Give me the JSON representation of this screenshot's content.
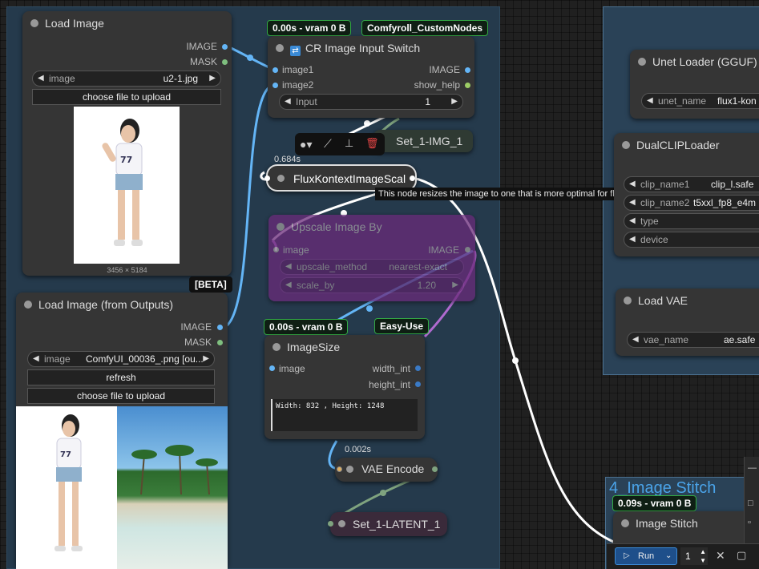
{
  "colors": {
    "canvas": "#202020",
    "group_blue": "#2a4257",
    "node_bg": "#353535",
    "wire_blue": "#64b5f6",
    "wire_white": "#ffffff",
    "wire_green": "#7fa37f",
    "wire_purple": "#b06ad0",
    "accent_blue": "#3a8ad6",
    "delete_red": "#e04444"
  },
  "group_stitch": {
    "title": "4_Image Stitch"
  },
  "load_image": {
    "title": "Load Image",
    "out_image": "IMAGE",
    "out_mask": "MASK",
    "image_label": "image",
    "image_value": "u2-1.jpg",
    "upload_label": "choose file to upload",
    "dims": "3456 × 5184"
  },
  "load_image_outputs": {
    "beta_badge": "[BETA]",
    "title": "Load Image (from Outputs)",
    "out_image": "IMAGE",
    "out_mask": "MASK",
    "image_label": "image",
    "image_value": "ComfyUI_00036_.png [ou...",
    "refresh_label": "refresh",
    "upload_label": "choose file to upload"
  },
  "cr_switch": {
    "badge_time": "0.00s - vram 0 B",
    "badge_pack": "Comfyroll_CustomNodes",
    "title": "CR Image Input Switch",
    "in_image1": "image1",
    "in_image2": "image2",
    "out_image": "IMAGE",
    "out_help": "show_help",
    "input_label": "Input",
    "input_value": "1"
  },
  "set_img": {
    "title": "Set_1-IMG_1"
  },
  "flux_scale": {
    "time": "0.684s",
    "title": "FluxKontextImageScal",
    "tooltip": "This node resizes the image to one that is more optimal for flux kontext."
  },
  "upscale": {
    "title": "Upscale Image By",
    "in_image": "image",
    "out_image": "IMAGE",
    "method_label": "upscale_method",
    "method_value": "nearest-exact",
    "scale_label": "scale_by",
    "scale_value": "1.20"
  },
  "image_size": {
    "badge_time": "0.00s - vram 0 B",
    "badge_pack": "Easy-Use",
    "title": "ImageSize",
    "in_image": "image",
    "out_width": "width_int",
    "out_height": "height_int",
    "display": "Width: 832 , Height: 1248"
  },
  "vae_encode": {
    "time": "0.002s",
    "title": "VAE Encode"
  },
  "set_latent": {
    "title": "Set_1-LATENT_1"
  },
  "unet_loader": {
    "title": "Unet Loader (GGUF)",
    "label": "unet_name",
    "value": "flux1-kon"
  },
  "dual_clip": {
    "title": "DualCLIPLoader",
    "clip1_label": "clip_name1",
    "clip1_value": "clip_l.safe",
    "clip2_label": "clip_name2",
    "clip2_value": "t5xxl_fp8_e4m",
    "type_label": "type",
    "device_label": "device"
  },
  "load_vae": {
    "title": "Load VAE",
    "label": "vae_name",
    "value": "ae.safe"
  },
  "image_stitch": {
    "badge_time": "0.09s - vram 0 B",
    "title": "Image Stitch"
  },
  "run_bar": {
    "run_label": "Run",
    "count": "1"
  }
}
